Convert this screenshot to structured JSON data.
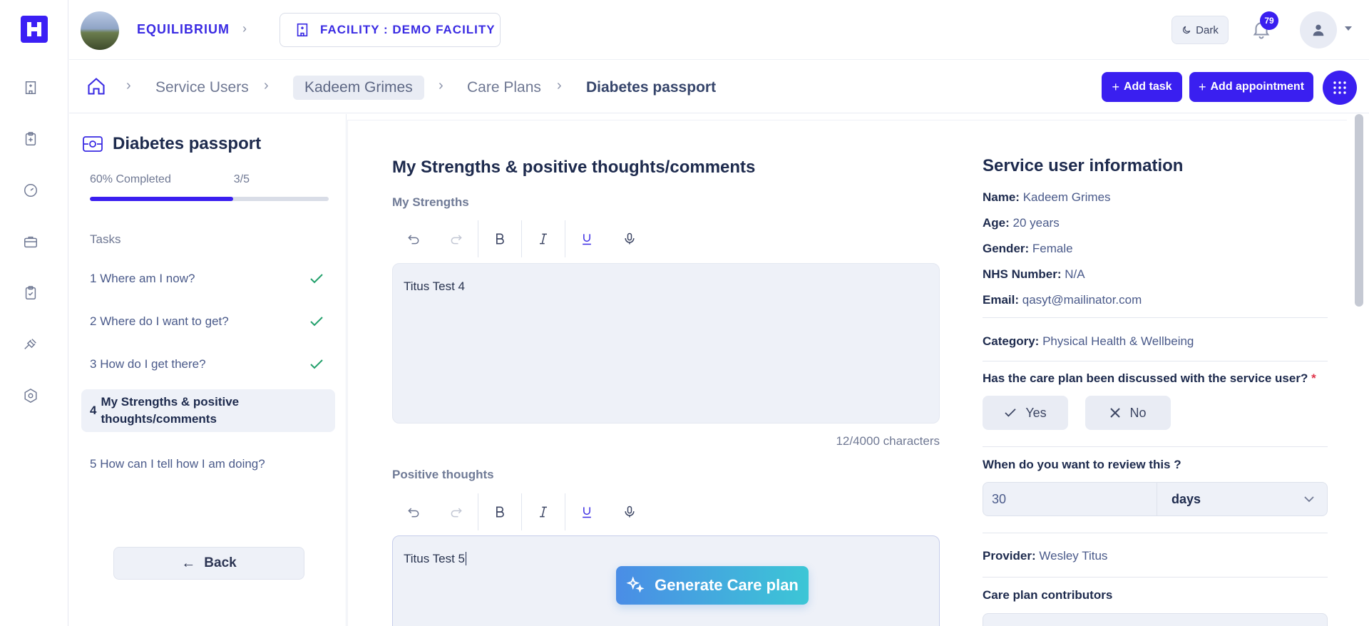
{
  "topbar": {
    "org_name": "EQUILIBRIUM",
    "facility_label": "FACILITY : DEMO FACILITY",
    "theme_label": "Dark",
    "notification_count": "79"
  },
  "breadcrumb": {
    "items": [
      "Service Users",
      "Kadeem Grimes",
      "Care Plans"
    ],
    "current": "Diabetes passport"
  },
  "actions": {
    "add_task": "Add task",
    "add_appointment": "Add appointment"
  },
  "left_panel": {
    "title": "Diabetes passport",
    "progress_label": "60% Completed",
    "progress_count": "3/5",
    "progress_fraction": 0.6,
    "tasks_heading": "Tasks",
    "tasks": [
      {
        "number": "1",
        "label": "Where am I now?",
        "done": true
      },
      {
        "number": "2",
        "label": "Where do I want to get?",
        "done": true
      },
      {
        "number": "3",
        "label": "How do I get there?",
        "done": true
      },
      {
        "number": "4",
        "label": "My Strengths & positive thoughts/comments",
        "done": false,
        "active": true
      },
      {
        "number": "5",
        "label": "How can I tell how I am doing?",
        "done": false
      }
    ],
    "back_label": "Back"
  },
  "main": {
    "section_title": "My Strengths & positive thoughts/comments",
    "strengths": {
      "label": "My Strengths",
      "value": "Titus Test 4",
      "char_count": "12/4000 characters"
    },
    "positive": {
      "label": "Positive thoughts",
      "value": "Titus Test 5"
    },
    "generate_label": "Generate Care plan"
  },
  "service_user": {
    "title": "Service user information",
    "name_label": "Name:",
    "name": "Kadeem Grimes",
    "age_label": "Age:",
    "age": "20 years",
    "gender_label": "Gender:",
    "gender": "Female",
    "nhs_label": "NHS Number:",
    "nhs": "N/A",
    "email_label": "Email:",
    "email": "qasyt@mailinator.com",
    "category_label": "Category:",
    "category": "Physical Health & Wellbeing",
    "discussed_question": "Has the care plan been discussed with the service user?",
    "required_mark": "*",
    "yes_label": "Yes",
    "no_label": "No",
    "review_question": "When do you want to review this ?",
    "review_value": "30",
    "review_unit": "days",
    "provider_label": "Provider:",
    "provider": "Wesley Titus",
    "contributors_label": "Care plan contributors"
  },
  "colors": {
    "brand": "#3a1ff0",
    "success": "#22a06b",
    "generate_gradient_start": "#4a8de6",
    "generate_gradient_end": "#3cc6d6"
  }
}
